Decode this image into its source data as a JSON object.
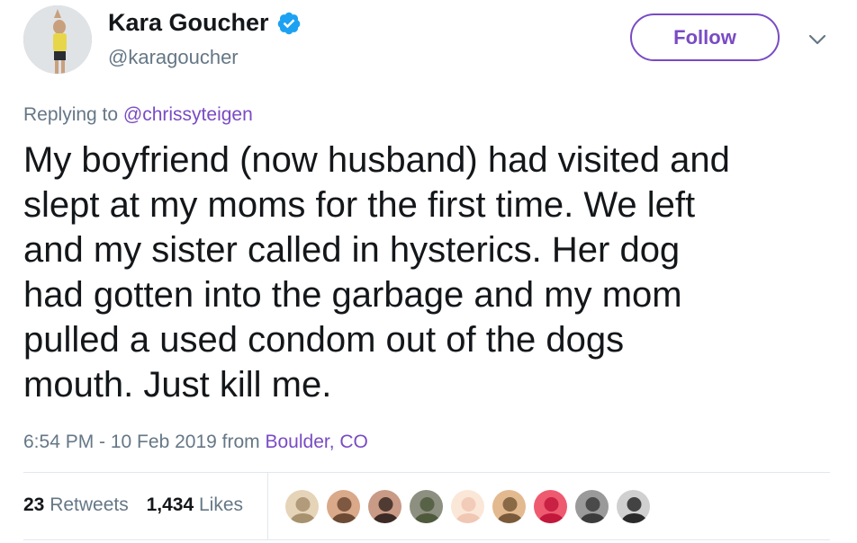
{
  "author": {
    "display_name": "Kara Goucher",
    "handle": "@karagoucher",
    "verified_icon": "verified-badge-icon",
    "avatar": "profile-photo"
  },
  "actions": {
    "follow_label": "Follow",
    "menu_icon": "chevron-down-icon"
  },
  "reply_context": {
    "prefix": "Replying to",
    "user": "@chrissyteigen"
  },
  "tweet": {
    "lines": [
      "My boyfriend (now husband) had visited and",
      "slept at my moms for the first time. We left",
      "and my sister called in hysterics. Her dog",
      "had gotten into the garbage and my mom",
      "pulled a used condom out of the dogs",
      "mouth. Just kill me."
    ]
  },
  "meta": {
    "timestamp": "6:54 PM - 10 Feb 2019",
    "from_word": "from",
    "location": "Boulder, CO"
  },
  "stats": {
    "retweets_count": "23",
    "retweets_label": "Retweets",
    "likes_count": "1,434",
    "likes_label": "Likes"
  },
  "likers": [
    {
      "name": "liker-avatar-1",
      "color_a": "#a8916e",
      "color_b": "#e6d4b8"
    },
    {
      "name": "liker-avatar-2",
      "color_a": "#6d4a34",
      "color_b": "#d9a98a"
    },
    {
      "name": "liker-avatar-3",
      "color_a": "#3b2a25",
      "color_b": "#c99a85"
    },
    {
      "name": "liker-avatar-4",
      "color_a": "#4f5a3d",
      "color_b": "#8d8f80"
    },
    {
      "name": "liker-avatar-5",
      "color_a": "#f0c7b3",
      "color_b": "#fbe7d8"
    },
    {
      "name": "liker-avatar-6",
      "color_a": "#7a5a3a",
      "color_b": "#e3b98f"
    },
    {
      "name": "liker-avatar-7",
      "color_a": "#c2183c",
      "color_b": "#ee5a6f"
    },
    {
      "name": "liker-avatar-8",
      "color_a": "#3c3c3c",
      "color_b": "#9a9a9a"
    },
    {
      "name": "liker-avatar-9",
      "color_a": "#2a2a2a",
      "color_b": "#d0d0d0"
    }
  ],
  "colors": {
    "accent": "#794bc4",
    "text": "#14171a",
    "secondary": "#657786",
    "divider": "#e1e8ed",
    "verified": "#1da1f2"
  }
}
